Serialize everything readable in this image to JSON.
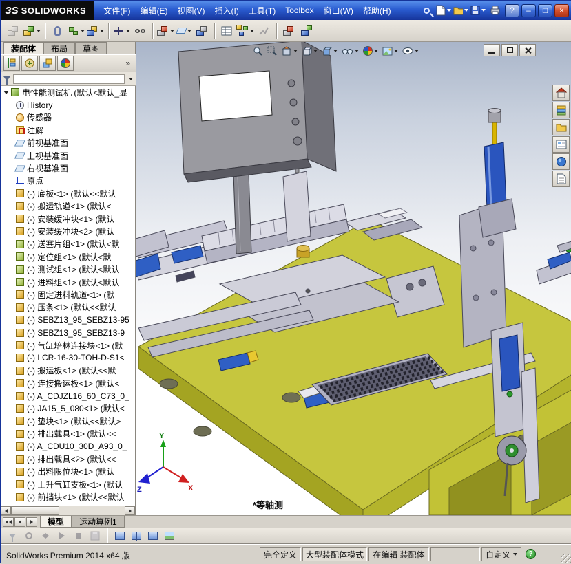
{
  "titlebar": {
    "logo_mark": "ЗS",
    "logo_text": "SOLIDWORKS",
    "menus": [
      "文件(F)",
      "编辑(E)",
      "视图(V)",
      "插入(I)",
      "工具(T)",
      "Toolbox",
      "窗口(W)",
      "帮助(H)"
    ],
    "help_glyph": "?",
    "window_controls": {
      "minimize": "–",
      "maximize": "□",
      "close": "×"
    }
  },
  "left_panel": {
    "tabs": [
      {
        "label": "装配体",
        "active": true
      },
      {
        "label": "布局",
        "active": false
      },
      {
        "label": "草图",
        "active": false
      }
    ],
    "overflow_glyph": "»",
    "tree": {
      "root_label": "电性能测试机 (默认<默认_显",
      "items": [
        {
          "icon": "history",
          "label": "History"
        },
        {
          "icon": "sensor",
          "label": "传感器"
        },
        {
          "icon": "annotation",
          "label": "注解"
        },
        {
          "icon": "plane",
          "label": "前视基准面"
        },
        {
          "icon": "plane",
          "label": "上视基准面"
        },
        {
          "icon": "plane",
          "label": "右视基准面"
        },
        {
          "icon": "origin",
          "label": "原点"
        },
        {
          "icon": "part",
          "label": "(-) 底板<1> (默认<<默认"
        },
        {
          "icon": "part",
          "label": "(-) 搬运轨道<1> (默认<"
        },
        {
          "icon": "part",
          "label": "(-) 安装缓冲块<1> (默认"
        },
        {
          "icon": "part",
          "label": "(-) 安装缓冲块<2> (默认"
        },
        {
          "icon": "asm",
          "label": "(-) 送塞片组<1> (默认<默"
        },
        {
          "icon": "asm",
          "label": "(-) 定位组<1> (默认<默"
        },
        {
          "icon": "asm",
          "label": "(-) 测试组<1> (默认<默认"
        },
        {
          "icon": "asm",
          "label": "(-) 进料组<1> (默认<默认"
        },
        {
          "icon": "part",
          "label": "(-) 固定进料轨道<1> (默"
        },
        {
          "icon": "part",
          "label": "(-) 压条<1> (默认<<默认"
        },
        {
          "icon": "part",
          "label": "(-) SEBZ13_95_SEBZ13-95"
        },
        {
          "icon": "part",
          "label": "(-) SEBZ13_95_SEBZ13-9"
        },
        {
          "icon": "part",
          "label": "(-) 气缸培林连接块<1> (默"
        },
        {
          "icon": "part",
          "label": "(-) LCR-16-30-TOH-D-S1<"
        },
        {
          "icon": "part",
          "label": "(-) 搬运板<1> (默认<<默"
        },
        {
          "icon": "part",
          "label": "(-) 连接搬运板<1> (默认<"
        },
        {
          "icon": "part",
          "label": "(-) A_CDJZL16_60_C73_0_"
        },
        {
          "icon": "part",
          "label": "(-) JA15_5_080<1> (默认<"
        },
        {
          "icon": "part",
          "label": "(-) 垫块<1> (默认<<默认>"
        },
        {
          "icon": "part",
          "label": "(-) 排出载具<1> (默认<<"
        },
        {
          "icon": "part",
          "label": "(-) A_CDU10_30D_A93_0_"
        },
        {
          "icon": "part",
          "label": "(-) 排出载具<2> (默认<<"
        },
        {
          "icon": "part",
          "label": "(-) 出料限位块<1> (默认"
        },
        {
          "icon": "part",
          "label": "(-) 上升气缸支板<1> (默认"
        },
        {
          "icon": "part",
          "label": "(-) 前挡块<1> (默认<<默认"
        }
      ]
    }
  },
  "viewport": {
    "view_label": "*等轴测",
    "triad": {
      "x": "X",
      "y": "Y",
      "z": "Z"
    }
  },
  "bottom_tabs": {
    "tabs": [
      {
        "label": "模型",
        "active": true
      },
      {
        "label": "运动算例1",
        "active": false
      }
    ]
  },
  "statusbar": {
    "product": "SolidWorks Premium 2014 x64 版",
    "define_state": "完全定义",
    "assembly_mode": "大型装配体模式",
    "editing": "在编辑 装配体",
    "custom": "自定义",
    "help_glyph": "?"
  }
}
